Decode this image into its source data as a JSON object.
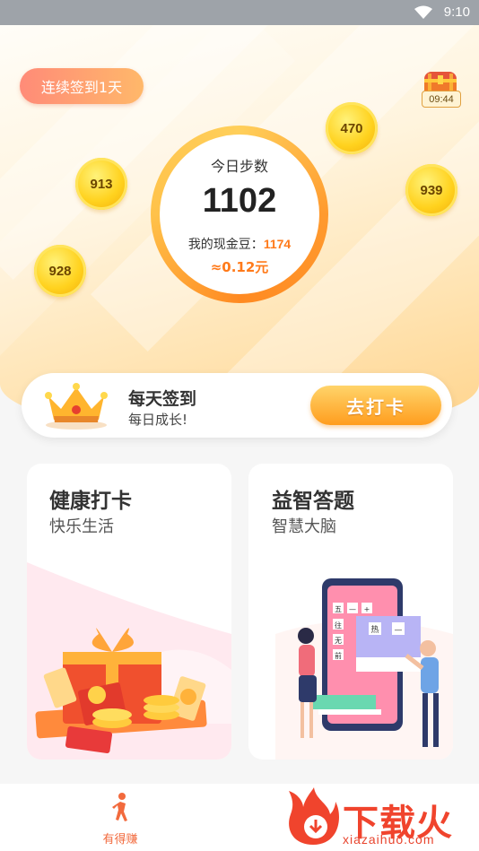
{
  "status_bar": {
    "time": "9:10"
  },
  "hero": {
    "signin_streak": "连续签到1天",
    "chest_timer": "09:44",
    "coins": [
      "470",
      "913",
      "939",
      "928"
    ],
    "steps_label": "今日步数",
    "steps_value": "1102",
    "beans_label": "我的现金豆：",
    "beans_value": "1174",
    "yuan_value": "≈0.12元"
  },
  "daily_checkin": {
    "title": "每天签到",
    "subtitle": "每日成长!",
    "button_label": "去打卡"
  },
  "cards": [
    {
      "title": "健康打卡",
      "subtitle": "快乐生活"
    },
    {
      "title": "益智答题",
      "subtitle": "智慧大脑"
    }
  ],
  "quiz_illustration": {
    "chars": [
      "五",
      "—",
      "+",
      "往",
      "无",
      "前",
      "热",
      "—"
    ]
  },
  "bottom_nav": {
    "tab_label": "有得赚"
  },
  "watermark": {
    "text": "下载火",
    "url": "xiazaihuo.com"
  },
  "colors": {
    "accent": "#ff7a1a",
    "nav_active": "#f26a3d",
    "coin": "#ffd21e"
  }
}
